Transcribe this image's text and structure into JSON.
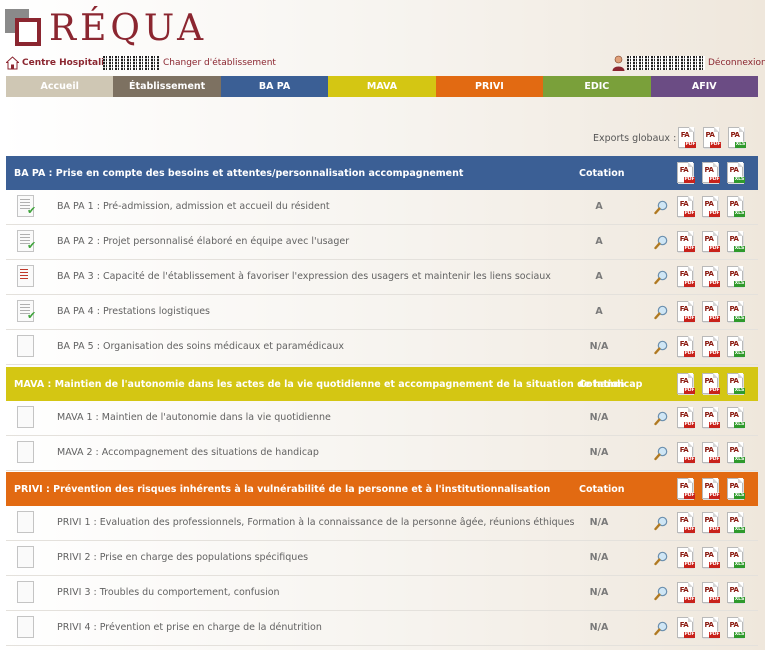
{
  "app": {
    "logo_text": "RÉQUA"
  },
  "subbar": {
    "establishment_label": "Centre Hospitalier",
    "change_link": "Changer d'établissement",
    "logout_link": "Déconnexion"
  },
  "nav": [
    {
      "label": "Accueil",
      "color": "#cfc7b4"
    },
    {
      "label": "Établissement",
      "color": "#7d7161"
    },
    {
      "label": "BA PA",
      "color": "#3b5f95"
    },
    {
      "label": "MAVA",
      "color": "#d4c613"
    },
    {
      "label": "PRIVI",
      "color": "#e26a12"
    },
    {
      "label": "EDIC",
      "color": "#7aa03a"
    },
    {
      "label": "AFIV",
      "color": "#6b4c84"
    }
  ],
  "exports": {
    "label": "Exports globaux :",
    "icons": [
      {
        "code": "FA",
        "badge": "PDF"
      },
      {
        "code": "PA",
        "badge": "PDF"
      },
      {
        "code": "PA",
        "badge": "XLS"
      }
    ]
  },
  "sections": [
    {
      "title": "BA PA : Prise en compte des besoins et attentes/personnalisation accompagnement",
      "cotation_label": "Cotation",
      "color": "#3b5f95",
      "rows": [
        {
          "label": "BA PA 1 : Pré-admission, admission et accueil du résident",
          "cotation": "A",
          "doc_icon": "checked-document-icon"
        },
        {
          "label": "BA PA 2 : Projet personnalisé élaboré en équipe avec l'usager",
          "cotation": "A",
          "doc_icon": "checked-document-icon"
        },
        {
          "label": "BA PA 3 : Capacité de l'établissement à favoriser l'expression des usagers et maintenir les liens sociaux",
          "cotation": "A",
          "doc_icon": "in-progress-document-icon"
        },
        {
          "label": "BA PA 4 : Prestations logistiques",
          "cotation": "A",
          "doc_icon": "checked-document-icon"
        },
        {
          "label": "BA PA 5 : Organisation des soins médicaux et paramédicaux",
          "cotation": "N/A",
          "doc_icon": "blank-document-icon"
        }
      ]
    },
    {
      "title": "MAVA : Maintien de l'autonomie dans les actes de la vie quotidienne et accompagnement de la situation de handicap",
      "cotation_label": "Cotation",
      "color": "#d4c613",
      "rows": [
        {
          "label": "MAVA 1 : Maintien de l'autonomie dans la vie quotidienne",
          "cotation": "N/A",
          "doc_icon": "blank-document-icon"
        },
        {
          "label": "MAVA 2 : Accompagnement des situations de handicap",
          "cotation": "N/A",
          "doc_icon": "blank-document-icon"
        }
      ]
    },
    {
      "title": "PRIVI : Prévention des risques inhérents à la vulnérabilité de la personne et à l'institutionnalisation",
      "cotation_label": "Cotation",
      "color": "#e26a12",
      "rows": [
        {
          "label": "PRIVI 1 : Evaluation des professionnels, Formation à la connaissance de la personne âgée, réunions éthiques",
          "cotation": "N/A",
          "doc_icon": "blank-document-icon"
        },
        {
          "label": "PRIVI 2 : Prise en charge des populations spécifiques",
          "cotation": "N/A",
          "doc_icon": "blank-document-icon"
        },
        {
          "label": "PRIVI 3 : Troubles du comportement, confusion",
          "cotation": "N/A",
          "doc_icon": "blank-document-icon"
        },
        {
          "label": "PRIVI 4 : Prévention et prise en charge de la dénutrition",
          "cotation": "N/A",
          "doc_icon": "blank-document-icon"
        }
      ]
    }
  ]
}
